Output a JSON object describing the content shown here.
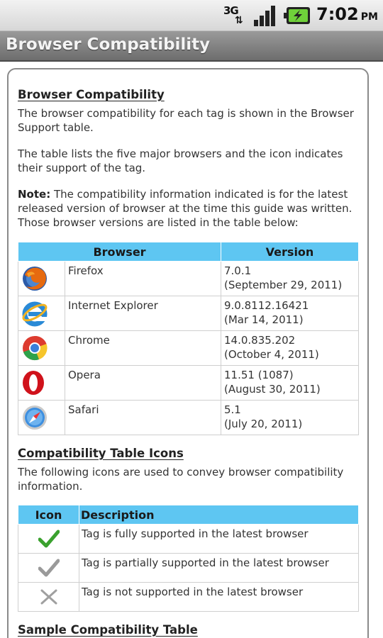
{
  "status_bar": {
    "network": "3G",
    "time": "7:02",
    "ampm": "PM"
  },
  "title_bar": {
    "title": "Browser Compatibility"
  },
  "content": {
    "heading": "Browser Compatibility",
    "para1": "The browser compatibility for each tag is shown in the Browser Support table.",
    "para2": "The table lists the five major browsers and the icon indicates their support of the tag.",
    "note_label": "Note:",
    "note_text": " The compatibility information indicated is for the latest released version of browser at the time this guide was written. Those browser versions are listed in the table below:",
    "browser_table": {
      "headers": [
        "Browser",
        "Version"
      ],
      "rows": [
        {
          "icon": "firefox-icon",
          "name": "Firefox",
          "version_line1": "7.0.1",
          "version_line2": "(September 29, 2011)"
        },
        {
          "icon": "internet-explorer-icon",
          "name": "Internet Explorer",
          "version_line1": "9.0.8112.16421",
          "version_line2": "(Mar 14, 2011)"
        },
        {
          "icon": "chrome-icon",
          "name": "Chrome",
          "version_line1": "14.0.835.202",
          "version_line2": "(October 4, 2011)"
        },
        {
          "icon": "opera-icon",
          "name": "Opera",
          "version_line1": "11.51 (1087)",
          "version_line2": "(August 30, 2011)"
        },
        {
          "icon": "safari-icon",
          "name": "Safari",
          "version_line1": "5.1",
          "version_line2": "(July 20, 2011)"
        }
      ]
    },
    "icons_heading": "Compatibility Table Icons",
    "icons_para": "The following icons are used to convey browser compatibility information.",
    "icon_table": {
      "headers": [
        "Icon",
        "Description"
      ],
      "rows": [
        {
          "icon": "green-check-icon",
          "description": "Tag is fully supported in the latest browser"
        },
        {
          "icon": "gray-check-icon",
          "description": "Tag is partially supported in the latest browser"
        },
        {
          "icon": "gray-x-icon",
          "description": "Tag is not supported in the latest browser"
        }
      ]
    },
    "sample_heading": "Sample Compatibility Table"
  },
  "colors": {
    "table_header": "#5ec6f2",
    "title_bar": "#808080",
    "check_green": "#3aa12e",
    "check_gray": "#9a9a9a"
  }
}
